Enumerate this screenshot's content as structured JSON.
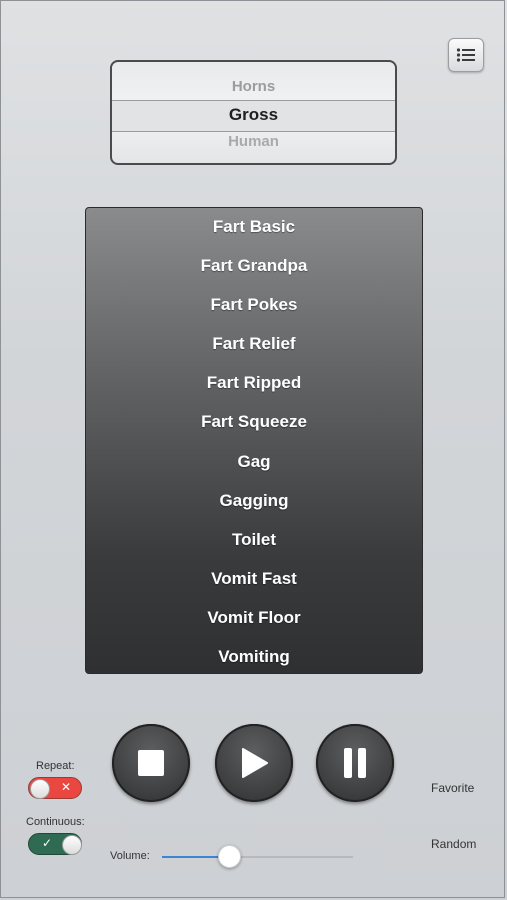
{
  "picker": {
    "above": "Horns",
    "selected": "Gross",
    "below": "Human"
  },
  "sounds": [
    "Fart Basic",
    "Fart Grandpa",
    "Fart Pokes",
    "Fart Relief",
    "Fart Ripped",
    "Fart Squeeze",
    "Gag",
    "Gagging",
    "Toilet",
    "Vomit Fast",
    "Vomit Floor",
    "Vomiting"
  ],
  "controls": {
    "repeat_label": "Repeat:",
    "repeat_on": false,
    "continuous_label": "Continuous:",
    "continuous_on": true,
    "volume_label": "Volume:",
    "volume_level": 0.35,
    "favorite_label": "Favorite",
    "random_label": "Random"
  },
  "icons": {
    "menu": "list-icon",
    "stop": "stop-icon",
    "play": "play-icon",
    "pause": "pause-icon"
  },
  "colors": {
    "toggle_off": "#e9473f",
    "toggle_on": "#2f6b52",
    "slider_accent": "#3a86d6"
  }
}
